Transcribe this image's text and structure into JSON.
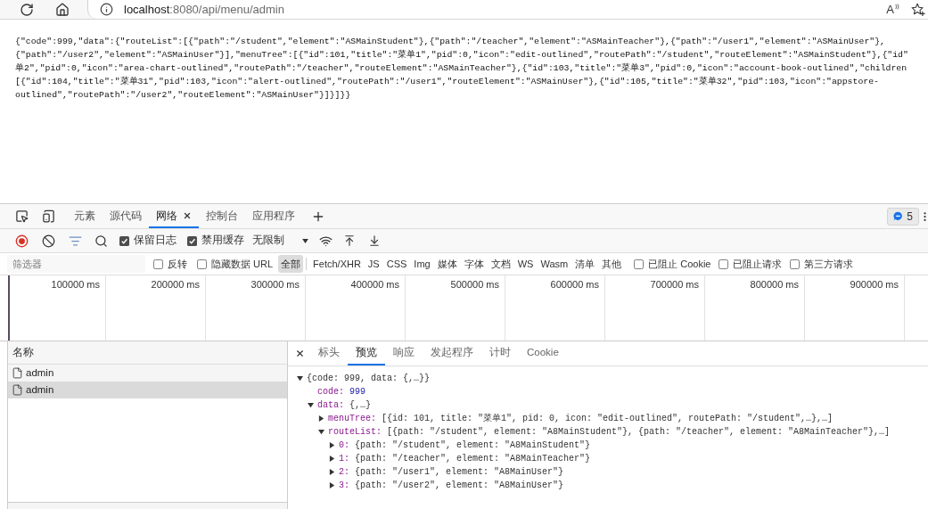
{
  "address_bar": {
    "url": {
      "host": "localhost",
      "rest": ":8080/api/menu/admin"
    },
    "read_aloud": "A"
  },
  "page": {
    "lines": [
      "{\"code\":999,\"data\":{\"routeList\":[{\"path\":\"/student\",\"element\":\"ASMainStudent\"},{\"path\":\"/teacher\",\"element\":\"ASMainTeacher\"},{\"path\":\"/user1\",\"element\":\"ASMainUser\"},",
      "{\"path\":\"/user2\",\"element\":\"ASMainUser\"}],\"menuTree\":[{\"id\":101,\"title\":\"菜单1\",\"pid\":0,\"icon\":\"edit-outlined\",\"routePath\":\"/student\",\"routeElement\":\"ASMainStudent\"},{\"id\"",
      "单2\",\"pid\":0,\"icon\":\"area-chart-outlined\",\"routePath\":\"/teacher\",\"routeElement\":\"ASMainTeacher\"},{\"id\":103,\"title\":\"菜单3\",\"pid\":0,\"icon\":\"account-book-outlined\",\"children",
      "[{\"id\":104,\"title\":\"菜单31\",\"pid\":103,\"icon\":\"alert-outlined\",\"routePath\":\"/user1\",\"routeElement\":\"ASMainUser\"},{\"id\":105,\"title\":\"菜单32\",\"pid\":103,\"icon\":\"appstore-",
      "outlined\",\"routePath\":\"/user2\",\"routeElement\":\"ASMainUser\"}]}]}}"
    ]
  },
  "devtools": {
    "tabs": [
      {
        "label": "元素",
        "selected": false
      },
      {
        "label": "源代码",
        "selected": false
      },
      {
        "label": "网络",
        "selected": true
      },
      {
        "label": "控制台",
        "selected": false
      },
      {
        "label": "应用程序",
        "selected": false
      }
    ],
    "issues_count": "5",
    "toolbar": {
      "recording": true,
      "checkboxes": [
        {
          "label": "保留日志",
          "checked": true
        },
        {
          "label": "禁用缓存",
          "checked": true
        }
      ],
      "throttle": "无限制"
    },
    "filter": {
      "placeholder": "筛选器",
      "options": [
        {
          "label": "反转",
          "checked": false
        },
        {
          "label": "隐藏数据 URL",
          "checked": false
        }
      ],
      "types": [
        {
          "label": "全部",
          "selected": true
        },
        {
          "label": "Fetch/XHR",
          "selected": false
        },
        {
          "label": "JS",
          "selected": false
        },
        {
          "label": "CSS",
          "selected": false
        },
        {
          "label": "Img",
          "selected": false
        },
        {
          "label": "媒体",
          "selected": false
        },
        {
          "label": "字体",
          "selected": false
        },
        {
          "label": "文档",
          "selected": false
        },
        {
          "label": "WS",
          "selected": false
        },
        {
          "label": "Wasm",
          "selected": false
        },
        {
          "label": "清单",
          "selected": false
        },
        {
          "label": "其他",
          "selected": false
        }
      ],
      "blocked": [
        {
          "label": "已阻止 Cookie",
          "checked": false
        },
        {
          "label": "已阻止请求",
          "checked": false
        },
        {
          "label": "第三方请求",
          "checked": false
        }
      ]
    },
    "timeline": {
      "ticks": [
        "100000 ms",
        "200000 ms",
        "300000 ms",
        "400000 ms",
        "500000 ms",
        "600000 ms",
        "700000 ms",
        "800000 ms",
        "900000 ms"
      ]
    },
    "requests": {
      "header": "名称",
      "rows": [
        {
          "name": "admin",
          "selected": false
        },
        {
          "name": "admin",
          "selected": true
        }
      ]
    },
    "detail": {
      "tabs": [
        {
          "label": "标头",
          "selected": false
        },
        {
          "label": "预览",
          "selected": true
        },
        {
          "label": "响应",
          "selected": false
        },
        {
          "label": "发起程序",
          "selected": false
        },
        {
          "label": "计时",
          "selected": false
        },
        {
          "label": "Cookie",
          "selected": false
        }
      ],
      "tree": [
        {
          "kind": "object",
          "expanded": true,
          "value": "{code: 999, data: {,…}}",
          "children": [
            {
              "kind": "leaf",
              "key": "code:",
              "value": "999"
            },
            {
              "kind": "object",
              "expanded": true,
              "key": "data:",
              "value": "{,…}",
              "children": [
                {
                  "kind": "object",
                  "expanded": false,
                  "key": "menuTree:",
                  "value": "[{id: 101, title: \"菜单1\", pid: 0, icon: \"edit-outlined\", routePath: \"/student\",…},…]"
                },
                {
                  "kind": "object",
                  "expanded": true,
                  "key": "routeList:",
                  "value": "[{path: \"/student\", element: \"A8MainStudent\"}, {path: \"/teacher\", element: \"A8MainTeacher\"},…]",
                  "children": [
                    {
                      "kind": "object",
                      "expanded": false,
                      "key": "0:",
                      "value": "{path: \"/student\", element: \"A8MainStudent\"}"
                    },
                    {
                      "kind": "object",
                      "expanded": false,
                      "key": "1:",
                      "value": "{path: \"/teacher\", element: \"A8MainTeacher\"}"
                    },
                    {
                      "kind": "object",
                      "expanded": false,
                      "key": "2:",
                      "value": "{path: \"/user1\", element: \"A8MainUser\"}"
                    },
                    {
                      "kind": "object",
                      "expanded": false,
                      "key": "3:",
                      "value": "{path: \"/user2\", element: \"A8MainUser\"}"
                    }
                  ]
                }
              ]
            }
          ]
        }
      ]
    }
  }
}
